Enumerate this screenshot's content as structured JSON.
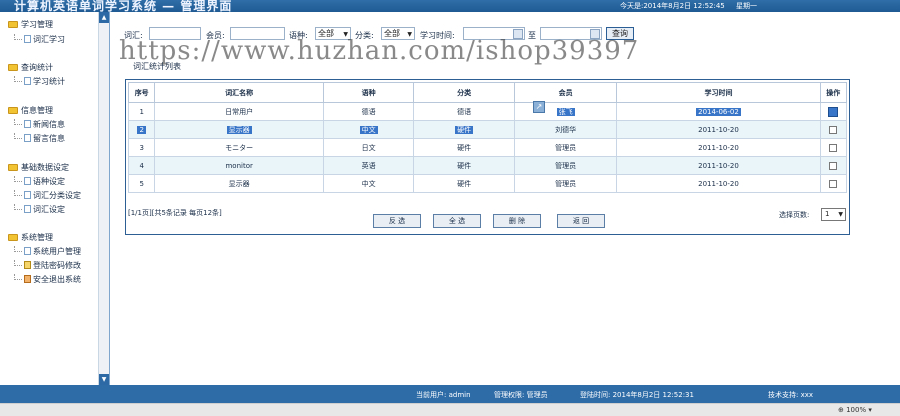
{
  "header": {
    "title": "计算机英语单词学习系统 — 管理界面",
    "date": "今天是:2014年8月2日 12:52:45",
    "week": "星期一"
  },
  "sidebar": {
    "groups": [
      {
        "label": "学习管理",
        "items": [
          {
            "label": "词汇学习"
          }
        ]
      },
      {
        "label": "查询统计",
        "items": [
          {
            "label": "学习统计"
          }
        ]
      },
      {
        "label": "信息管理",
        "items": [
          {
            "label": "新闻信息"
          },
          {
            "label": "留言信息"
          }
        ]
      },
      {
        "label": "基础数据设定",
        "items": [
          {
            "label": "语种设定"
          },
          {
            "label": "词汇分类设定"
          },
          {
            "label": "词汇设定"
          }
        ]
      },
      {
        "label": "系统管理",
        "items": [
          {
            "label": "系统用户管理"
          },
          {
            "label": "登陆密码修改"
          },
          {
            "label": "安全退出系统"
          }
        ]
      }
    ]
  },
  "search": {
    "vocab_label": "词汇:",
    "member_label": "会员:",
    "lang_label": "语种:",
    "lang_value": "全部",
    "cat_label": "分类:",
    "cat_value": "全部",
    "time_label": "学习时间:",
    "to_label": "至",
    "button": "查询"
  },
  "watermark": "https://www.huzhan.com/ishop39397",
  "list_caption": "词汇统计列表",
  "table": {
    "headers": [
      "序号",
      "词汇名称",
      "语种",
      "分类",
      "会员",
      "学习时间",
      "操作"
    ],
    "rows": [
      {
        "no": "1",
        "name": "日常用户",
        "lang": "德语",
        "cat": "德语",
        "member": "张飞",
        "time": "2014-06-02"
      },
      {
        "no": "2",
        "name": "显示器",
        "lang": "中文",
        "cat": "硬件",
        "member": "刘德华",
        "time": "2011-10-20"
      },
      {
        "no": "3",
        "name": "モニター",
        "lang": "日文",
        "cat": "硬件",
        "member": "管理员",
        "time": "2011-10-20"
      },
      {
        "no": "4",
        "name": "monitor",
        "lang": "英语",
        "cat": "硬件",
        "member": "管理员",
        "time": "2011-10-20"
      },
      {
        "no": "5",
        "name": "显示器",
        "lang": "中文",
        "cat": "硬件",
        "member": "管理员",
        "time": "2011-10-20"
      }
    ]
  },
  "pager": {
    "summary": "[1/1页][共5条记录 每页12条]",
    "select_label": "选择页数:",
    "page_value": "1"
  },
  "actions": {
    "invert": "反 选",
    "select_all": "全 选",
    "delete": "删 除",
    "back": "返 回"
  },
  "status": {
    "user": "当前用户: admin",
    "perm": "管理权限: 管理员",
    "login": "登陆时间: 2014年8月2日 12:52:31",
    "support": "技术支持: xxx"
  },
  "browser": {
    "zoom": "100%"
  }
}
